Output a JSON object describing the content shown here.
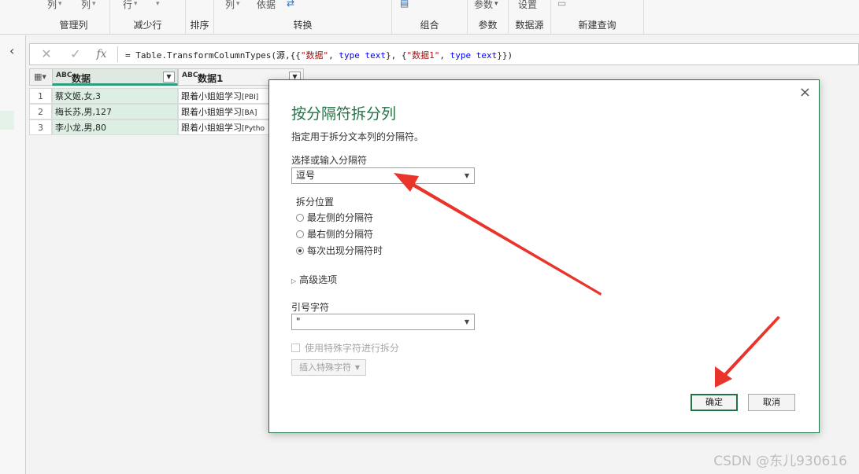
{
  "ribbon": {
    "groups": [
      {
        "label": "管理列",
        "top_items": [
          "列",
          "列"
        ]
      },
      {
        "label": "减少行",
        "top_items": [
          "行"
        ]
      },
      {
        "label": "排序",
        "top_items": [
          ""
        ]
      },
      {
        "label": "转换",
        "top_items": [
          "列",
          "依据"
        ]
      },
      {
        "label": "组合",
        "top_items": [
          ""
        ]
      },
      {
        "label": "参数",
        "top_items": [
          "参数"
        ]
      },
      {
        "label": "数据源",
        "top_items": [
          "设置"
        ]
      },
      {
        "label": "新建查询",
        "top_items": [
          ""
        ]
      }
    ]
  },
  "formula_bar": {
    "cancel_icon": "x-icon",
    "confirm_icon": "check-icon",
    "fx_label": "fx",
    "prefix": "= Table.TransformColumnTypes(源,{{",
    "str1": "\"数据\"",
    "mid1": ", ",
    "kw1": "type text",
    "mid2": "}, {",
    "str2": "\"数据1\"",
    "mid3": ", ",
    "kw2": "type text",
    "suffix": "}})"
  },
  "grid": {
    "columns": [
      {
        "type_label": "ABC",
        "name": "数据"
      },
      {
        "type_label": "ABC",
        "name": "数据1"
      }
    ],
    "rows": [
      {
        "num": "1",
        "c1": "蔡文姬,女,3",
        "c2": "跟着小姐姐学习",
        "c2_tag": "[PBI]"
      },
      {
        "num": "2",
        "c1": "梅长苏,男,127",
        "c2": "跟着小姐姐学习",
        "c2_tag": "[BA]"
      },
      {
        "num": "3",
        "c1": "李小龙,男,80",
        "c2": "跟着小姐姐学习",
        "c2_tag": "[Pytho"
      }
    ]
  },
  "dialog": {
    "close_icon": "×",
    "title": "按分隔符拆分列",
    "description": "指定用于拆分文本列的分隔符。",
    "delimiter_label": "选择或输入分隔符",
    "delimiter_value": "逗号",
    "split_at_label": "拆分位置",
    "split_options": [
      {
        "label": "最左侧的分隔符",
        "selected": false
      },
      {
        "label": "最右侧的分隔符",
        "selected": false
      },
      {
        "label": "每次出现分隔符时",
        "selected": true
      }
    ],
    "advanced_label": "高级选项",
    "quote_label": "引号字符",
    "quote_value": "\"",
    "special_chars_label": "使用特殊字符进行拆分",
    "insert_special_label": "插入特殊字符",
    "ok_label": "确定",
    "cancel_label": "取消"
  },
  "watermark": "CSDN @东儿930616",
  "colors": {
    "accent": "#217346",
    "arrow": "#e8342b"
  }
}
